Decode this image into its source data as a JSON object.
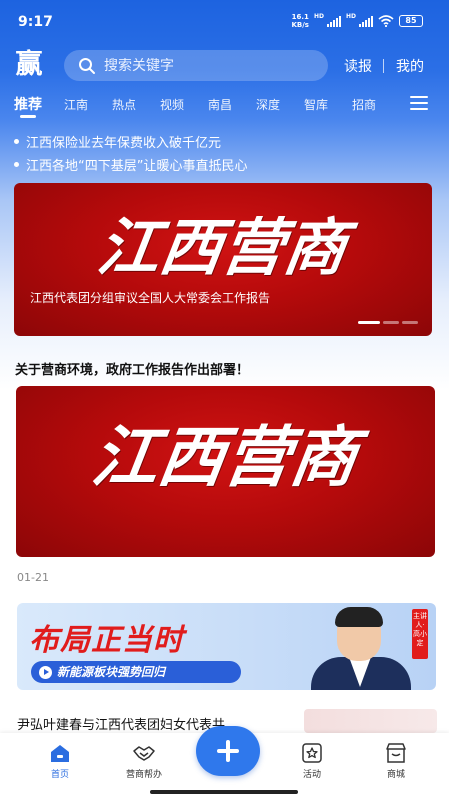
{
  "status_bar": {
    "time": "9:17",
    "net_speed_value": "16.1",
    "net_speed_unit": "KB/s",
    "hd1": "HD",
    "hd2": "HD",
    "battery": "85"
  },
  "header": {
    "logo_char": "赢",
    "search_placeholder": "搜索关键字",
    "read_label": "读报",
    "mine_label": "我的"
  },
  "nav": {
    "tabs": [
      "推荐",
      "江南",
      "热点",
      "视频",
      "南昌",
      "深度",
      "智库",
      "招商"
    ],
    "active_index": 0
  },
  "ticker": [
    "江西保险业去年保费收入破千亿元",
    "江西各地“四下基层”让暖心事直抵民心"
  ],
  "banner1": {
    "calligraphy": "江西营商",
    "caption": "江西代表团分组审议全国人大常委会工作报告",
    "slides": 3,
    "active_slide": 0
  },
  "article1": {
    "title": "关于营商环境，政府工作报告作出部署！",
    "image_calligraphy": "江西营商",
    "date": "01-21"
  },
  "ad": {
    "title": "布局正当时",
    "subtitle": "新能源板块强势回归",
    "tag": "主讲人·高小定"
  },
  "article2": {
    "title": "尹弘叶建春与江西代表团妇女代表共"
  },
  "tabbar": {
    "tabs": [
      {
        "label": "首页",
        "icon": "home-icon",
        "active": true
      },
      {
        "label": "营商帮办",
        "icon": "handshake-icon",
        "active": false
      },
      {
        "label": "活动",
        "icon": "star-badge-icon",
        "active": false
      },
      {
        "label": "商城",
        "icon": "shop-icon",
        "active": false
      }
    ],
    "fab_icon": "plus-icon"
  },
  "colors": {
    "brand_blue": "#1d63e0",
    "banner_red": "#b50a0b",
    "ad_red": "#e11c1c",
    "active_tab": "#2b6de0"
  }
}
